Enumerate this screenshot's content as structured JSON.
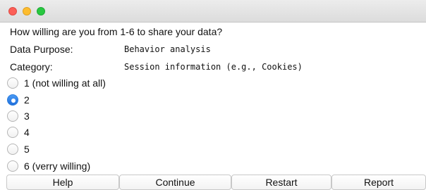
{
  "dialog": {
    "question": "How willing are you from 1-6 to share your data?",
    "purpose_label": "Data Purpose:",
    "purpose_value": "Behavior analysis",
    "category_label": "Category:",
    "category_value": "Session information (e.g., Cookies)"
  },
  "options": [
    {
      "label": "1 (not willing at all)",
      "selected": false
    },
    {
      "label": "2",
      "selected": true
    },
    {
      "label": "3",
      "selected": false
    },
    {
      "label": "4",
      "selected": false
    },
    {
      "label": "5",
      "selected": false
    },
    {
      "label": "6 (verry willing)",
      "selected": false
    }
  ],
  "buttons": {
    "help": "Help",
    "continue": "Continue",
    "restart": "Restart",
    "report": "Report"
  },
  "colors": {
    "accent": "#1f6fdb",
    "close": "#fc5f57",
    "minimize": "#fdbc2e",
    "maximize": "#28c840"
  }
}
